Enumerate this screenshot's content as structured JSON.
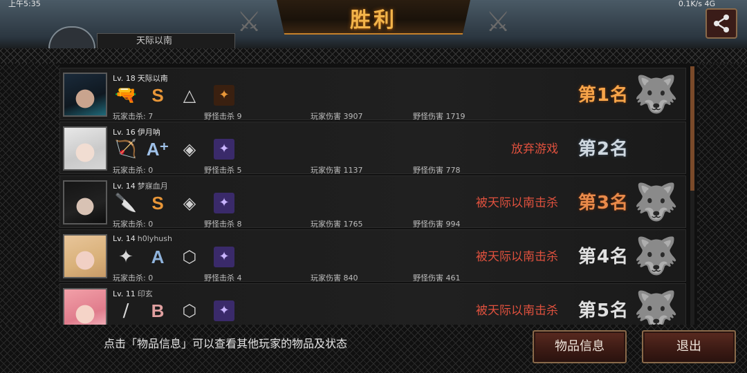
{
  "status_bar": {
    "left": "上午5:35",
    "right": "0.1K/s 4G"
  },
  "title": "胜利",
  "behind_tab_label": "天际以南",
  "players": [
    {
      "level": "Lv. 18",
      "name": "天际以南",
      "grade": "S",
      "player_kills": "玩家击杀: 7",
      "monster_kills": "野怪击杀 9",
      "player_damage": "玩家伤害 3907",
      "monster_damage": "野怪伤害 1719",
      "status": "",
      "rank": "第1名"
    },
    {
      "level": "Lv. 16",
      "name": "伊月呐",
      "grade": "A⁺",
      "player_kills": "玩家击杀: 0",
      "monster_kills": "野怪击杀 5",
      "player_damage": "玩家伤害 1137",
      "monster_damage": "野怪伤害 778",
      "status": "放弃游戏",
      "rank": "第2名"
    },
    {
      "level": "Lv. 14",
      "name": "梦寐血月",
      "grade": "S",
      "player_kills": "玩家击杀: 0",
      "monster_kills": "野怪击杀 8",
      "player_damage": "玩家伤害 1765",
      "monster_damage": "野怪伤害 994",
      "status": "被天际以南击杀",
      "rank": "第3名"
    },
    {
      "level": "Lv. 14",
      "name": "h0lyhush",
      "grade": "A",
      "player_kills": "玩家击杀: 0",
      "monster_kills": "野怪击杀 4",
      "player_damage": "玩家伤害 840",
      "monster_damage": "野怪伤害 461",
      "status": "被天际以南击杀",
      "rank": "第4名"
    },
    {
      "level": "Lv. 11",
      "name": "印玄",
      "grade": "B",
      "player_kills": "",
      "monster_kills": "",
      "player_damage": "",
      "monster_damage": "",
      "status": "被天际以南击杀",
      "rank": "第5名"
    }
  ],
  "hint": "点击「物品信息」可以查看其他玩家的物品及状态",
  "buttons": {
    "item_info": "物品信息",
    "exit": "退出"
  },
  "colors": {
    "accent_gold": "#f3b44a",
    "status_red": "#e0513e",
    "button_fill": "#3b1a14"
  },
  "icons": [
    "share-icon",
    "pistol-icon",
    "bow-icon",
    "knife-icon",
    "shuriken-icon",
    "bat-icon",
    "armor-icon",
    "item-icon",
    "wolf-emblem-icon"
  ]
}
